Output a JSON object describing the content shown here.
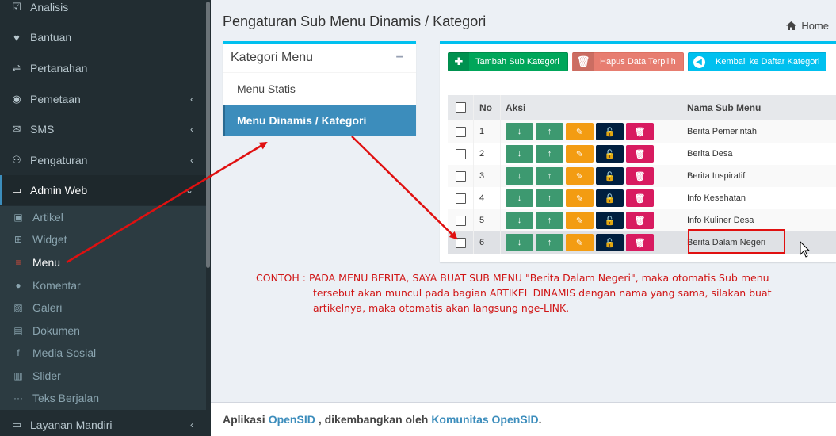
{
  "sidebar": {
    "items": [
      {
        "label": "Analisis",
        "icon": "check-square-icon",
        "glyph": "☑"
      },
      {
        "label": "Bantuan",
        "icon": "heart-icon",
        "glyph": "♥"
      },
      {
        "label": "Pertanahan",
        "icon": "road-sign-icon",
        "glyph": "⇌"
      },
      {
        "label": "Pemetaan",
        "icon": "globe-icon",
        "glyph": "◉"
      },
      {
        "label": "SMS",
        "icon": "envelope-icon",
        "glyph": "✉"
      },
      {
        "label": "Pengaturan",
        "icon": "users-icon",
        "glyph": "⚇"
      },
      {
        "label": "Admin Web",
        "icon": "desktop-icon",
        "glyph": "▭"
      }
    ],
    "subitems": [
      {
        "label": "Artikel",
        "icon": "file-image-icon",
        "glyph": "▣"
      },
      {
        "label": "Widget",
        "icon": "windows-icon",
        "glyph": "⊞"
      },
      {
        "label": "Menu",
        "icon": "bars-icon",
        "glyph": "≡"
      },
      {
        "label": "Komentar",
        "icon": "comments-icon",
        "glyph": "●"
      },
      {
        "label": "Galeri",
        "icon": "image-icon",
        "glyph": "▨"
      },
      {
        "label": "Dokumen",
        "icon": "file-icon",
        "glyph": "▤"
      },
      {
        "label": "Media Sosial",
        "icon": "facebook-icon",
        "glyph": "f"
      },
      {
        "label": "Slider",
        "icon": "film-icon",
        "glyph": "▥"
      },
      {
        "label": "Teks Berjalan",
        "icon": "ellipsis-icon",
        "glyph": "···"
      }
    ],
    "bottom": {
      "label": "Layanan Mandiri",
      "icon": "desktop-icon",
      "glyph": "▭"
    }
  },
  "header": {
    "title": "Pengaturan Sub Menu Dinamis / Kategori",
    "breadcrumb_home": "Home"
  },
  "kategori": {
    "title": "Kategori Menu",
    "links": [
      "Menu Statis",
      "Menu Dinamis / Kategori"
    ]
  },
  "toolbar": {
    "add_label": "Tambah Sub Kategori",
    "delete_label": "Hapus Data Terpilih",
    "back_label": "Kembali ke Daftar Kategori"
  },
  "table": {
    "columns": [
      "No",
      "Aksi",
      "Nama Sub Menu"
    ],
    "rows": [
      {
        "no": "1",
        "name": "Berita Pemerintah"
      },
      {
        "no": "2",
        "name": "Berita Desa"
      },
      {
        "no": "3",
        "name": "Berita Inspiratif"
      },
      {
        "no": "4",
        "name": "Info Kesehatan"
      },
      {
        "no": "5",
        "name": "Info Kuliner Desa"
      },
      {
        "no": "6",
        "name": "Berita Dalam Negeri"
      }
    ]
  },
  "note": {
    "line1": "CONTOH : PADA MENU BERITA, SAYA BUAT SUB MENU \"Berita Dalam Negeri\", maka otomatis Sub menu",
    "line2": "tersebut akan muncul pada bagian ARTIKEL DINAMIS dengan nama yang sama, silakan buat",
    "line3": "artikelnya, maka otomatis akan langsung nge-LINK."
  },
  "footer": {
    "prefix": "Aplikasi",
    "app_link": "OpenSID",
    "middle": ", dikembangkan oleh",
    "community_link": "Komunitas OpenSID",
    "suffix": "."
  },
  "colors": {
    "sidebar_bg": "#222d32",
    "accent_blue": "#3c8dbc",
    "box_border": "#00c0ef",
    "annotation_red": "#e01010"
  }
}
